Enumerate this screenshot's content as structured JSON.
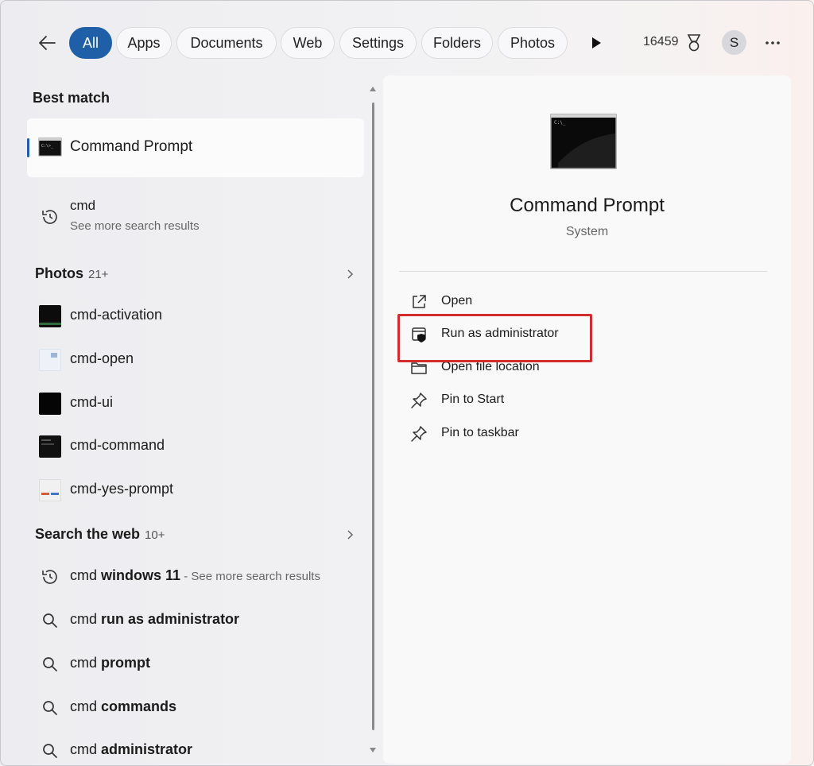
{
  "filters": {
    "tabs": [
      "All",
      "Apps",
      "Documents",
      "Web",
      "Settings",
      "Folders",
      "Photos"
    ],
    "active": "All"
  },
  "account": {
    "points": "16459",
    "avatar_initial": "S"
  },
  "best_match": {
    "heading": "Best match",
    "title": "Command Prompt"
  },
  "search_more": {
    "title": "cmd",
    "subtitle": "See more search results"
  },
  "photos": {
    "heading": "Photos",
    "count": "21+",
    "items": [
      "cmd-activation",
      "cmd-open",
      "cmd-ui",
      "cmd-command",
      "cmd-yes-prompt"
    ]
  },
  "web": {
    "heading": "Search the web",
    "count": "10+",
    "items": [
      {
        "prefix": "cmd ",
        "bold": "windows 11",
        "suffix": " - See more search results"
      },
      {
        "prefix": "cmd ",
        "bold": "run as administrator",
        "suffix": ""
      },
      {
        "prefix": "cmd ",
        "bold": "prompt",
        "suffix": ""
      },
      {
        "prefix": "cmd ",
        "bold": "commands",
        "suffix": ""
      },
      {
        "prefix": "cmd ",
        "bold": "administrator",
        "suffix": ""
      }
    ]
  },
  "detail": {
    "title": "Command Prompt",
    "subtitle": "System",
    "actions": [
      "Open",
      "Run as administrator",
      "Open file location",
      "Pin to Start",
      "Pin to taskbar"
    ]
  },
  "colors": {
    "accent": "#1f5fa8",
    "highlight": "#d32c2c"
  }
}
